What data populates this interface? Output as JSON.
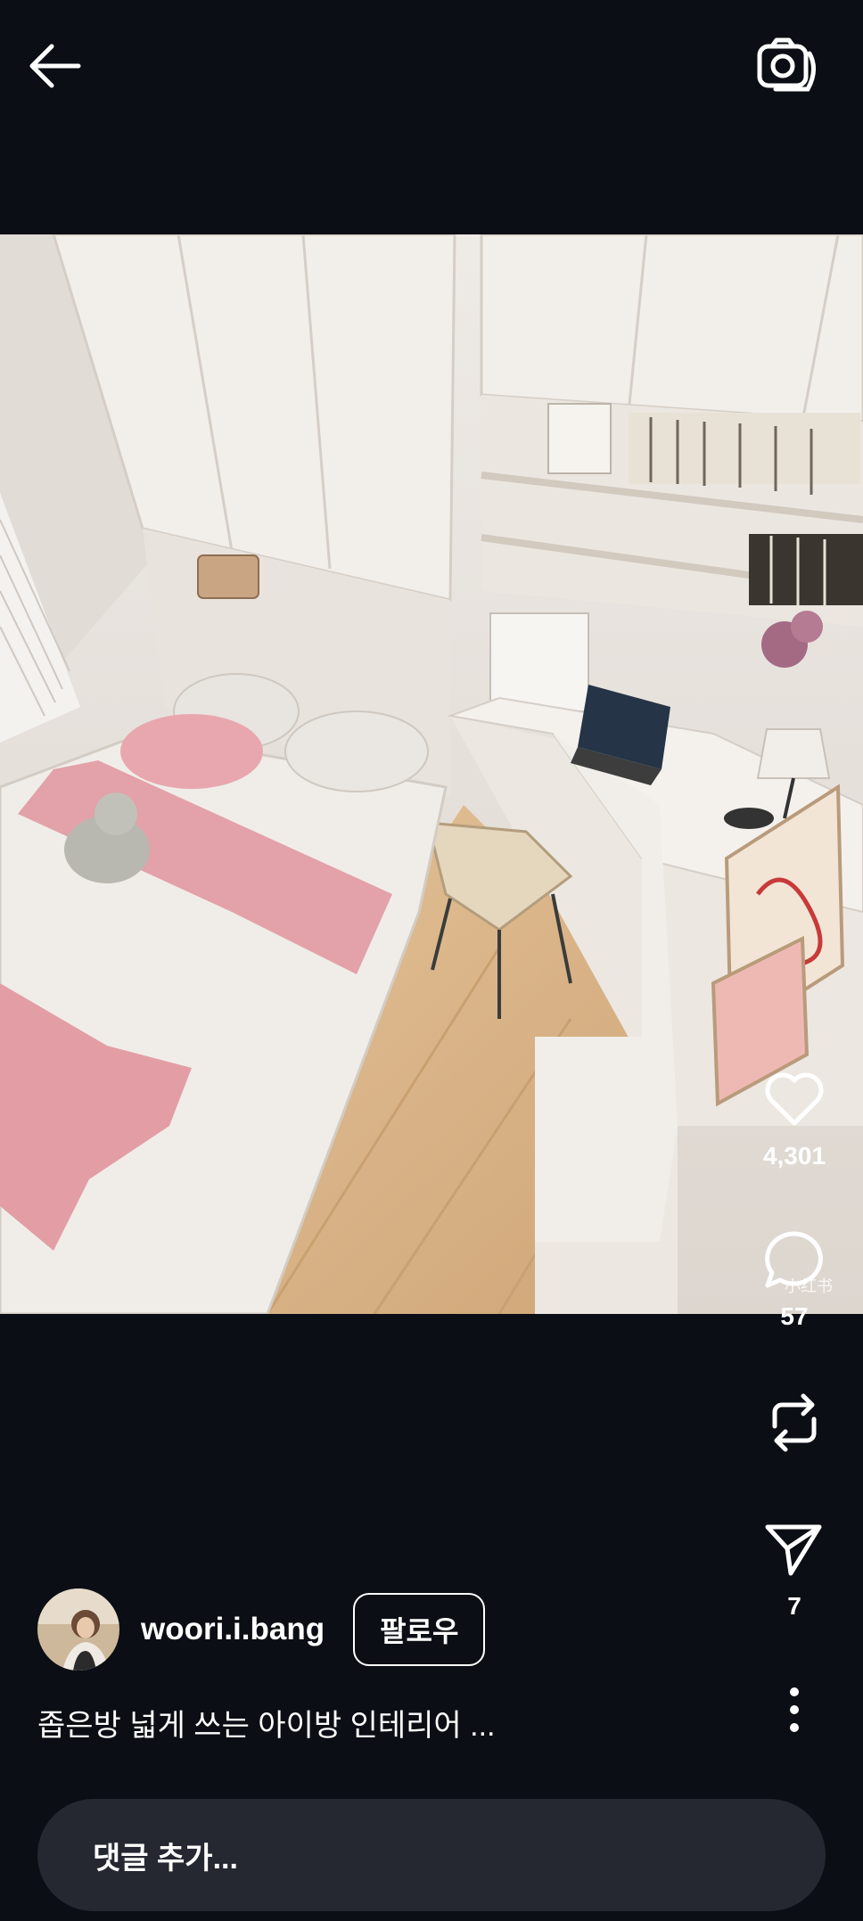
{
  "header": {
    "back_icon": "arrow-left-icon",
    "camera_icon": "camera-rotate-icon"
  },
  "media": {
    "watermark": "小红书"
  },
  "actions": {
    "likes": "4,301",
    "comments": "57",
    "shares": "7"
  },
  "author": {
    "username": "woori.i.bang",
    "follow_label": "팔로우"
  },
  "caption": "좁은방 넓게 쓰는 아이방 인테리어 ...",
  "comment": {
    "placeholder": "댓글 추가..."
  },
  "colors": {
    "background": "#0b0e14",
    "input_bg": "#252830",
    "text": "#ffffff"
  }
}
